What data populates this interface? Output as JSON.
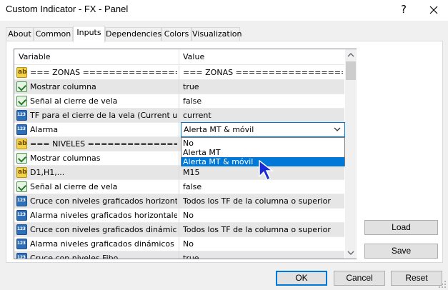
{
  "window": {
    "title": "Custom Indicator - FX - Panel",
    "help_glyph": "?",
    "close_icon": "close-icon"
  },
  "tabs": [
    {
      "label": "About"
    },
    {
      "label": "Common"
    },
    {
      "label": "Inputs",
      "active": true
    },
    {
      "label": "Dependencies"
    },
    {
      "label": "Colors"
    },
    {
      "label": "Visualization"
    }
  ],
  "grid": {
    "headers": {
      "variable": "Variable",
      "value": "Value"
    },
    "rows": [
      {
        "icon": "ab-string-icon",
        "name": "=== ZONAS ========================...",
        "value": "=== ZONAS ==========================="
      },
      {
        "icon": "bool-icon",
        "name": "Mostrar columna",
        "value": "true"
      },
      {
        "icon": "bool-icon",
        "name": "Señal al cierre de vela",
        "value": "false"
      },
      {
        "icon": "number-icon",
        "name": "TF para el cierre de la vela (Current utiliza...",
        "value": "current"
      },
      {
        "icon": "number-icon",
        "name": "Alarma",
        "value": ""
      },
      {
        "icon": "ab-string-icon",
        "name": "=== NIVELES ======================...",
        "value": ""
      },
      {
        "icon": "bool-icon",
        "name": "Mostrar columnas",
        "value": ""
      },
      {
        "icon": "ab-string-icon",
        "name": "D1,H1,...",
        "value": "M15"
      },
      {
        "icon": "bool-icon",
        "name": "Señal al cierre de vela",
        "value": "false"
      },
      {
        "icon": "number-icon",
        "name": "Cruce con niveles graficados horizontales",
        "value": "Todos los TF de la columna o superior"
      },
      {
        "icon": "number-icon",
        "name": "Alarma niveles graficados horizontales",
        "value": "No"
      },
      {
        "icon": "number-icon",
        "name": "Cruce con niveles graficados dinámicos",
        "value": "Todos los TF de la columna o superior"
      },
      {
        "icon": "number-icon",
        "name": "Alarma niveles graficados dinámicos",
        "value": "No"
      },
      {
        "icon": "number-icon",
        "name": "Cruce con niveles Fibo",
        "value": "true"
      }
    ]
  },
  "combo": {
    "selected": "Alerta MT & móvil",
    "options": [
      "No",
      "Alerta MT",
      "Alerta MT & móvil"
    ],
    "highlighted_index": 2
  },
  "buttons": {
    "load": "Load",
    "save": "Save",
    "ok": "OK",
    "cancel": "Cancel",
    "reset": "Reset"
  },
  "colors": {
    "accent": "#0078d7",
    "selected_row": "#e6e6e6"
  }
}
